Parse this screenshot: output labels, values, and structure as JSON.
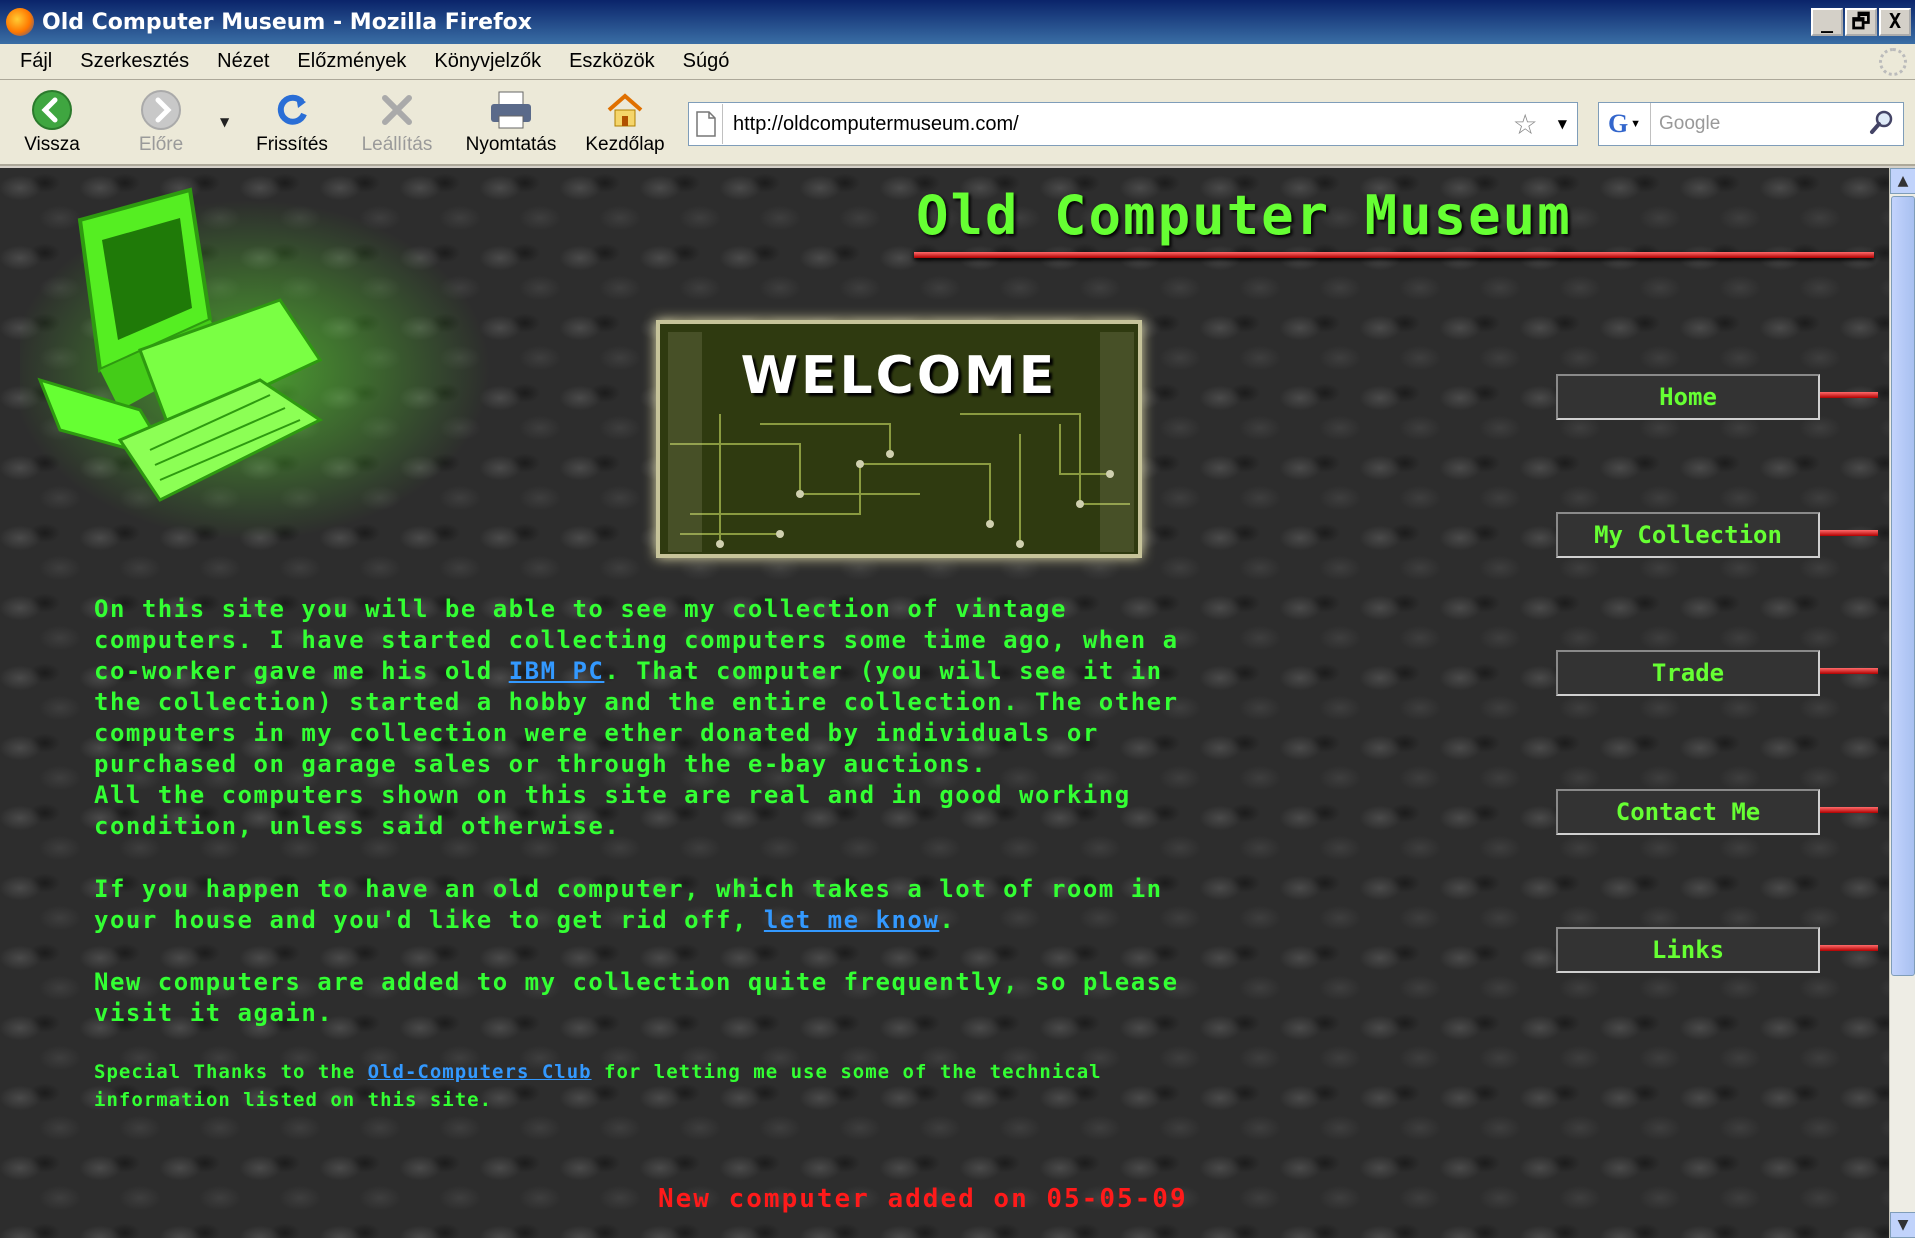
{
  "window": {
    "title": "Old Computer Museum - Mozilla Firefox",
    "controls": [
      "_",
      "🗗",
      "X"
    ]
  },
  "menu": [
    "Fájl",
    "Szerkesztés",
    "Nézet",
    "Előzmények",
    "Könyvjelzők",
    "Eszközök",
    "Súgó"
  ],
  "toolbar": {
    "back": "Vissza",
    "forward": "Előre",
    "reload": "Frissítés",
    "stop": "Leállítás",
    "print": "Nyomtatás",
    "home": "Kezdőlap"
  },
  "address": {
    "url": "http://oldcomputermuseum.com/"
  },
  "search": {
    "placeholder": "Google",
    "engine_letter": "G"
  },
  "page": {
    "site_title": "Old Computer Museum",
    "welcome": "WELCOME",
    "nav": [
      "Home",
      "My Collection",
      "Trade",
      "Contact Me",
      "Links"
    ],
    "p1_before": "On this site you will be able to see my collection of vintage\ncomputers. I have started collecting computers some time ago, when a\nco-worker gave me his old ",
    "p1_link": "IBM PC",
    "p1_after": ". That computer (you will see it in\nthe collection) started a hobby and the entire collection. The other\ncomputers in my collection were ether donated by individuals or\npurchased on garage sales or through the e-bay auctions.\nAll the computers shown on this site are real and in good working\ncondition, unless said otherwise.",
    "p2_before": "If you happen to have an old computer, which takes a lot of room in\nyour house and you'd like to get rid off, ",
    "p2_link": "let me know",
    "p2_after": ".",
    "p3": "New computers are added to my collection quite frequently, so please\nvisit it again.",
    "thanks_before": "Special Thanks to the ",
    "thanks_link": "Old-Computers Club",
    "thanks_after": " for letting me use some of the technical\ninformation listed on this site.",
    "news": "New computer added on 05-05-09"
  },
  "colors": {
    "text_green": "#33ff33",
    "title_green": "#66ff33",
    "link_blue": "#3399ff",
    "news_red": "#ff1a1a",
    "rule_red": "#cc0000"
  }
}
